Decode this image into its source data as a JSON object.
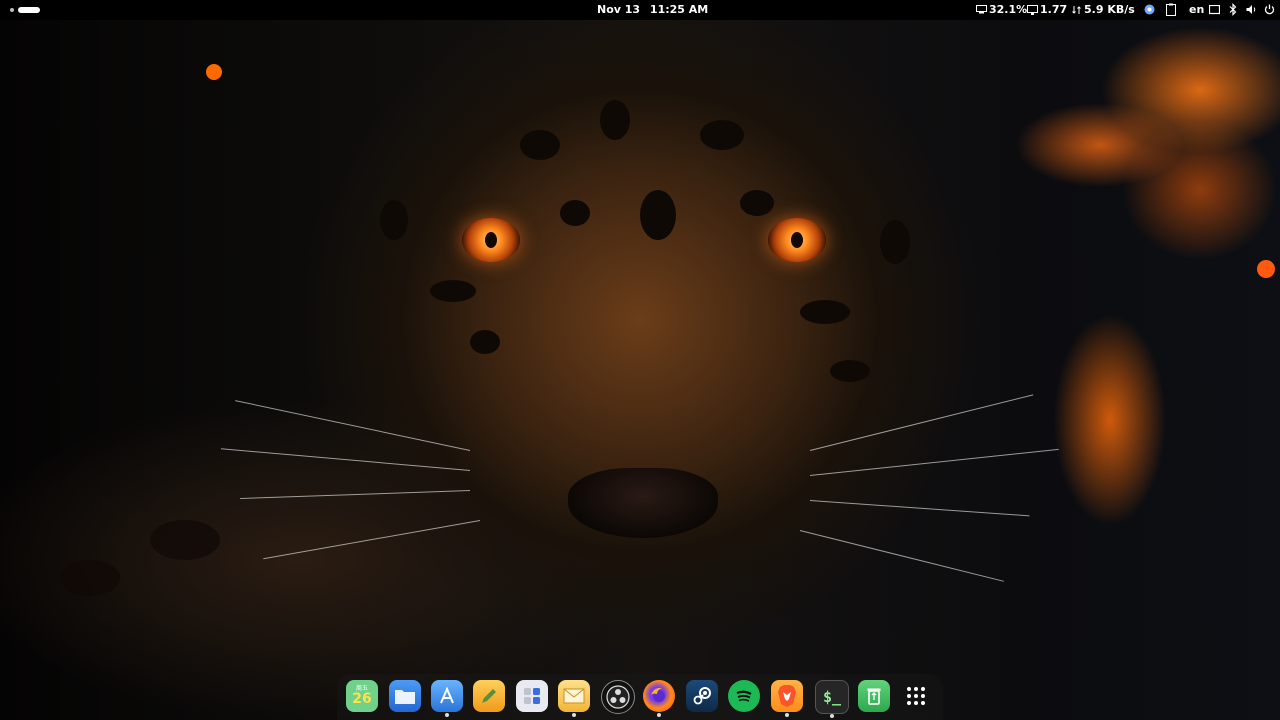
{
  "topbar": {
    "date": "Nov 13",
    "time": "11:25 AM",
    "cpu": "32.1%",
    "load": "1.77",
    "net_speed": "5.9 KB/s",
    "keyboard_layout": "en"
  },
  "dock": {
    "items": [
      {
        "name": "calendar",
        "label": "26",
        "sublabel": "周五",
        "color": "#5fcf7d"
      },
      {
        "name": "files",
        "color": "#2f7de8"
      },
      {
        "name": "app-store",
        "color": "#3e8ee8"
      },
      {
        "name": "notes",
        "color": "#f4a62a"
      },
      {
        "name": "calculator",
        "color": "#e8e8ee"
      },
      {
        "name": "mail",
        "color": "#f4c542"
      },
      {
        "name": "obs",
        "color": "#1a1a1a"
      },
      {
        "name": "firefox",
        "color": "#ff6b1a"
      },
      {
        "name": "steam",
        "color": "#1b3a57"
      },
      {
        "name": "spotify",
        "color": "#1db954"
      },
      {
        "name": "brave",
        "color": "#fb542b"
      },
      {
        "name": "terminal",
        "label": "$_",
        "color": "#2b2b2b"
      },
      {
        "name": "recycle",
        "color": "#3fbf5f"
      },
      {
        "name": "app-grid",
        "color": "transparent"
      }
    ]
  }
}
